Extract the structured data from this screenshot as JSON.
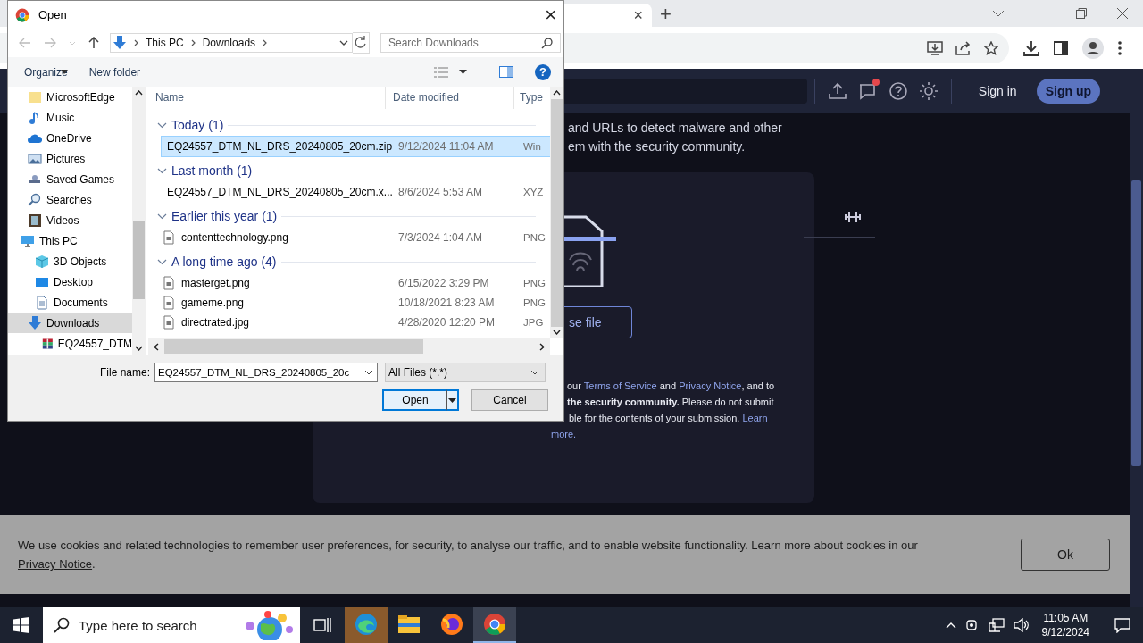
{
  "browser": {
    "tab_close": "×",
    "new_tab": "+"
  },
  "site": {
    "nav_icons": [
      {
        "kind": "upload",
        "notification": false
      },
      {
        "kind": "chat",
        "notification": true
      },
      {
        "kind": "help",
        "notification": false
      },
      {
        "kind": "theme",
        "notification": false
      }
    ],
    "sign_in": "Sign in",
    "sign_up": "Sign up",
    "intro": [
      "and URLs to detect malware and other",
      "em with the security community."
    ],
    "choose_button": "se file",
    "terms": [
      [
        {
          "kind": "text",
          "text": "our "
        },
        {
          "kind": "link",
          "text": "Terms of Service"
        },
        {
          "kind": "text",
          "text": " and "
        },
        {
          "kind": "link",
          "text": "Privacy Notice"
        },
        {
          "kind": "text",
          "text": ", and to"
        }
      ],
      [
        {
          "kind": "bold",
          "text": "the security community."
        },
        {
          "kind": "text",
          "text": " Please do not submit"
        }
      ],
      [
        {
          "kind": "text",
          "text": "ble for the contents of your submission. "
        },
        {
          "kind": "link",
          "text": "Learn"
        }
      ],
      [
        {
          "kind": "link",
          "text": "more."
        }
      ]
    ]
  },
  "cookie": {
    "text": "We use cookies and related technologies to remember user preferences, for security, to analyse our traffic, and to enable website functionality. Learn more about cookies in our ",
    "link": "Privacy Notice",
    "end": ".",
    "button": "Ok"
  },
  "dialog": {
    "title": "Open",
    "close": "×",
    "path": [
      "This PC",
      "Downloads"
    ],
    "search_placeholder": "Search Downloads",
    "organize": "Organize",
    "new_folder": "New folder",
    "help": "?",
    "nav": [
      {
        "label": "MicrosoftEdge",
        "kind": "folder",
        "selected": false
      },
      {
        "label": "Music",
        "kind": "music",
        "selected": false
      },
      {
        "label": "OneDrive",
        "kind": "cloud",
        "selected": false
      },
      {
        "label": "Pictures",
        "kind": "pictures",
        "selected": false
      },
      {
        "label": "Saved Games",
        "kind": "games",
        "selected": false
      },
      {
        "label": "Searches",
        "kind": "search",
        "selected": false
      },
      {
        "label": "Videos",
        "kind": "video",
        "selected": false
      },
      {
        "label": "This PC",
        "kind": "pc",
        "selected": false,
        "children": [
          {
            "label": "3D Objects",
            "kind": "cube",
            "selected": false
          },
          {
            "label": "Desktop",
            "kind": "desktop",
            "selected": false
          },
          {
            "label": "Documents",
            "kind": "documents",
            "selected": false
          },
          {
            "label": "Downloads",
            "kind": "download",
            "selected": true,
            "children": [
              {
                "label": "EQ24557_DTM",
                "kind": "archive",
                "selected": false
              }
            ]
          }
        ]
      }
    ],
    "columns": [
      "Name",
      "Date modified",
      "Type"
    ],
    "groups": [
      {
        "heading": "Today (1)",
        "files": [
          {
            "name": "EQ24557_DTM_NL_DRS_20240805_20cm.zip",
            "date": "9/12/2024 11:04 AM",
            "type": "Win",
            "kind": "archive",
            "selected": true
          }
        ]
      },
      {
        "heading": "Last month (1)",
        "files": [
          {
            "name": "EQ24557_DTM_NL_DRS_20240805_20cm.x...",
            "date": "8/6/2024 5:53 AM",
            "type": "XYZ",
            "kind": "blank",
            "selected": false
          }
        ]
      },
      {
        "heading": "Earlier this year (1)",
        "files": [
          {
            "name": "contenttechnology.png",
            "date": "7/3/2024 1:04 AM",
            "type": "PNG",
            "kind": "image",
            "selected": false
          }
        ]
      },
      {
        "heading": "A long time ago (4)",
        "files": [
          {
            "name": "masterget.png",
            "date": "6/15/2022 3:29 PM",
            "type": "PNG",
            "kind": "image",
            "selected": false
          },
          {
            "name": "gameme.png",
            "date": "10/18/2021 8:23 AM",
            "type": "PNG",
            "kind": "image",
            "selected": false
          },
          {
            "name": "directrated.jpg",
            "date": "4/28/2020 12:20 PM",
            "type": "JPG",
            "kind": "image",
            "selected": false
          }
        ]
      }
    ],
    "file_name_label": "File name:",
    "file_name": "EQ24557_DTM_NL_DRS_20240805_20c",
    "filter": "All Files (*.*)",
    "open": "Open",
    "cancel": "Cancel"
  },
  "taskbar": {
    "search_placeholder": "Type here to search",
    "apps": [
      {
        "kind": "edge",
        "selected": false,
        "flashing": true
      },
      {
        "kind": "explorer",
        "selected": false,
        "flashing": false
      },
      {
        "kind": "firefox",
        "selected": false,
        "flashing": false
      },
      {
        "kind": "chrome",
        "selected": true,
        "flashing": false
      }
    ],
    "time": "11:05 AM",
    "date": "9/12/2024"
  }
}
